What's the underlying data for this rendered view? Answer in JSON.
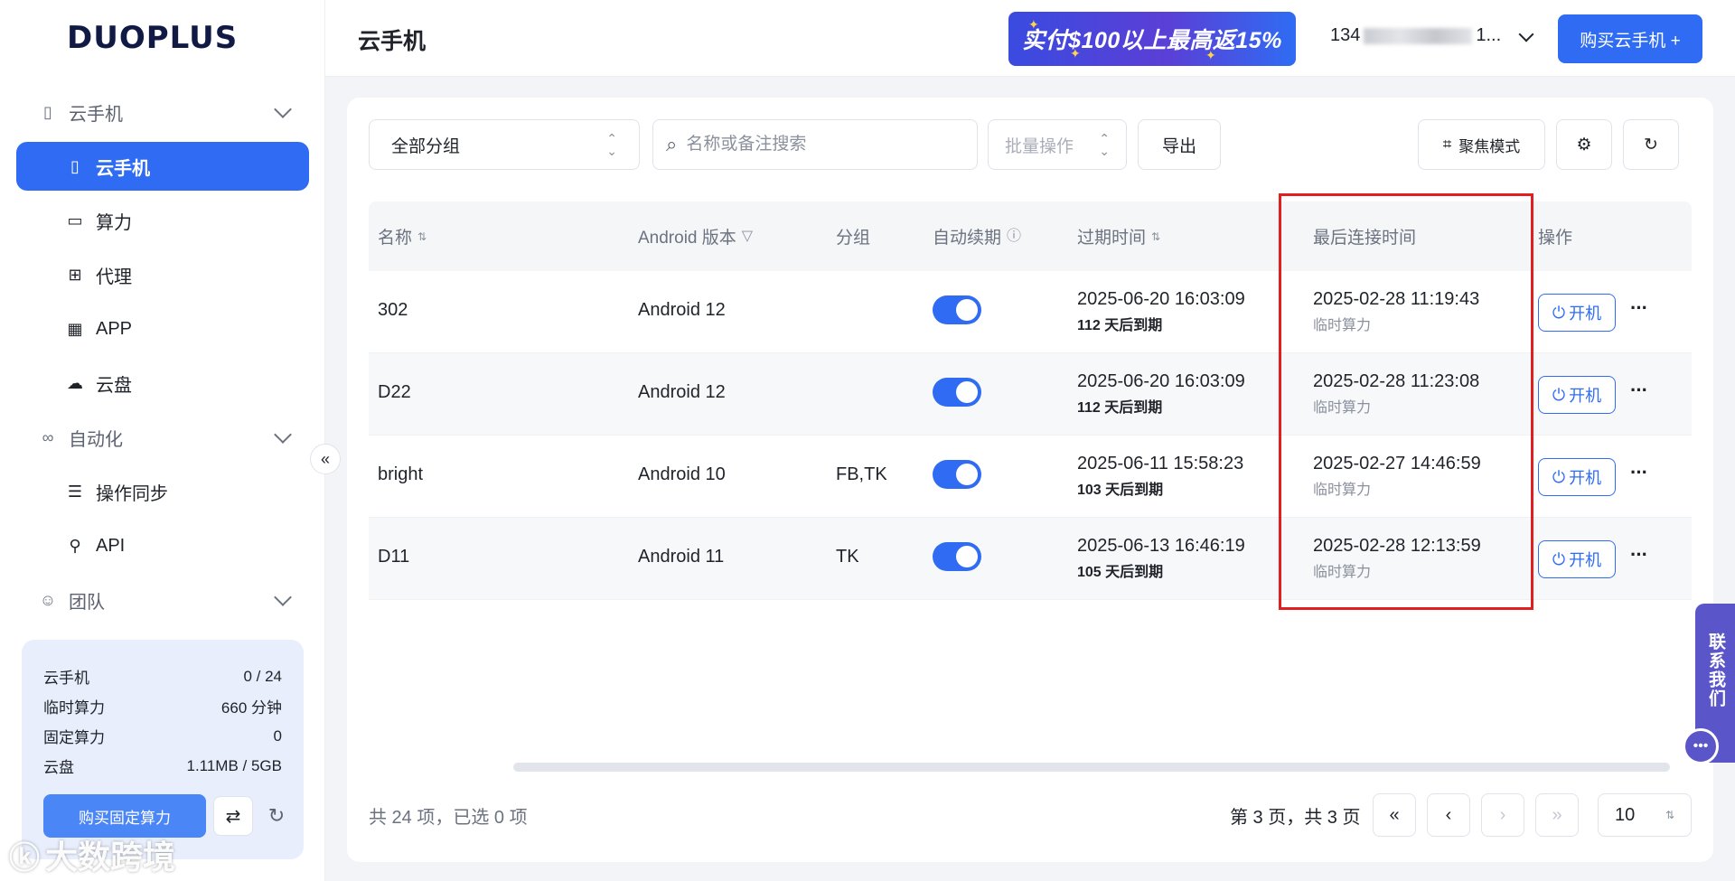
{
  "brand": {
    "logo_text": "DUOPLUS"
  },
  "sidebar": {
    "groups": [
      {
        "label": "云手机",
        "icon": "phone-icon"
      },
      {
        "label": "自动化",
        "icon": "infinity-icon"
      },
      {
        "label": "团队",
        "icon": "team-icon"
      }
    ],
    "items": [
      {
        "label": "云手机",
        "icon": "phone-icon",
        "active": true
      },
      {
        "label": "算力",
        "icon": "monitor-icon"
      },
      {
        "label": "代理",
        "icon": "proxy-icon"
      },
      {
        "label": "APP",
        "icon": "grid-icon"
      },
      {
        "label": "云盘",
        "icon": "cloud-icon"
      },
      {
        "label": "操作同步",
        "icon": "layers-icon"
      },
      {
        "label": "API",
        "icon": "plug-icon"
      }
    ],
    "quota": [
      {
        "label": "云手机",
        "value": "0 / 24"
      },
      {
        "label": "临时算力",
        "value": "660 分钟"
      },
      {
        "label": "固定算力",
        "value": "0"
      },
      {
        "label": "云盘",
        "value": "1.11MB / 5GB"
      }
    ],
    "buy_fixed_label": "购买固定算力"
  },
  "header": {
    "title": "云手机",
    "promo": "实付$100以上最高返15%",
    "account_prefix": "134",
    "account_suffix": "1...",
    "buy_label": "购买云手机 +"
  },
  "toolbar": {
    "group_select": "全部分组",
    "search_placeholder": "名称或备注搜索",
    "batch_label": "批量操作",
    "export_label": "导出",
    "focus_label": "聚焦模式"
  },
  "table": {
    "headers": {
      "name": "名称",
      "android": "Android 版本",
      "group": "分组",
      "auto_renew": "自动续期",
      "expire": "过期时间",
      "last_connect": "最后连接时间",
      "actions": "操作"
    },
    "rows": [
      {
        "name": "302",
        "android": "Android 12",
        "group": "",
        "auto_renew": true,
        "expire": "2025-06-20 16:03:09",
        "remaining": "112 天后到期",
        "last_connect": "2025-02-28 11:19:43",
        "compute": "临时算力",
        "power": "开机"
      },
      {
        "name": "D22",
        "android": "Android 12",
        "group": "",
        "auto_renew": true,
        "expire": "2025-06-20 16:03:09",
        "remaining": "112 天后到期",
        "last_connect": "2025-02-28 11:23:08",
        "compute": "临时算力",
        "power": "开机"
      },
      {
        "name": "bright",
        "android": "Android 10",
        "group": "FB,TK",
        "auto_renew": true,
        "expire": "2025-06-11 15:58:23",
        "remaining": "103 天后到期",
        "last_connect": "2025-02-27 14:46:59",
        "compute": "临时算力",
        "power": "开机"
      },
      {
        "name": "D11",
        "android": "Android 11",
        "group": "TK",
        "auto_renew": true,
        "expire": "2025-06-13 16:46:19",
        "remaining": "105 天后到期",
        "last_connect": "2025-02-28 12:13:59",
        "compute": "临时算力",
        "power": "开机"
      }
    ]
  },
  "footer": {
    "total": "共 24 项，已选 0 项",
    "page_info": "第 3 页，共 3 页",
    "page_size": "10"
  },
  "contact": {
    "label": "联系我们"
  },
  "watermark": {
    "text": "大数跨境"
  },
  "colors": {
    "primary": "#2f6cf3",
    "highlight": "#e02020",
    "contact": "#5a56c9"
  }
}
